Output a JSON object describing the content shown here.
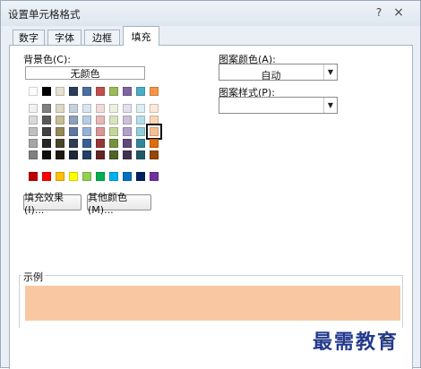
{
  "dialog": {
    "title": "设置单元格格式",
    "help": "?",
    "close": "×"
  },
  "tabs": [
    "数字",
    "字体",
    "边框",
    "填充"
  ],
  "fill": {
    "background_label": "背景色(C):",
    "no_color_label": "无颜色",
    "fill_effects_label": "填充效果(I)...",
    "more_colors_label": "其他颜色(M)...",
    "pattern_color_label": "图案颜色(A):",
    "pattern_color_value": "自动",
    "pattern_style_label": "图案样式(P):",
    "pattern_style_value": ""
  },
  "palette": {
    "theme_top": [
      "#ffffff",
      "#000000",
      "#e7e1d1",
      "#2a3c59",
      "#4a6fa2",
      "#c0504d",
      "#9bbb59",
      "#8064a2",
      "#4bacc6",
      "#f79646"
    ],
    "theme_tints": [
      [
        "#f2f2f2",
        "#7f7f7f",
        "#ddd9c4",
        "#c6d0df",
        "#dbe5f1",
        "#f2dcdb",
        "#ebf1de",
        "#e4dfec",
        "#daeef3",
        "#fde9d9"
      ],
      [
        "#d9d9d9",
        "#595959",
        "#c4bd97",
        "#8ea0bc",
        "#b8cce4",
        "#e6b8b7",
        "#d8e4bc",
        "#ccc0da",
        "#b7dee8",
        "#fcd5b4"
      ],
      [
        "#bfbfbf",
        "#404040",
        "#948a54",
        "#5e77a0",
        "#95b3d7",
        "#da9694",
        "#c4d79b",
        "#b1a0c7",
        "#92cddc",
        "#fabf8f"
      ],
      [
        "#a6a6a6",
        "#262626",
        "#494529",
        "#2f3d54",
        "#366092",
        "#963634",
        "#76933c",
        "#60497a",
        "#31869b",
        "#e26b0a"
      ],
      [
        "#808080",
        "#0d0d0d",
        "#1d1b10",
        "#1f2837",
        "#244062",
        "#632523",
        "#4f6228",
        "#403151",
        "#215967",
        "#974706"
      ]
    ],
    "standard": [
      "#c00000",
      "#ff0000",
      "#ffc000",
      "#ffff00",
      "#92d050",
      "#00b050",
      "#00b0f0",
      "#0070c0",
      "#002060",
      "#7030a0"
    ],
    "selected": "#fabf8f"
  },
  "sample": {
    "label": "示例",
    "color": "#f9c8a3"
  },
  "watermark": "最需教育"
}
